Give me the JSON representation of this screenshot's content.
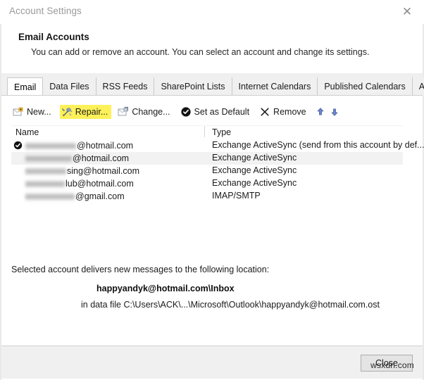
{
  "window": {
    "title": "Account Settings",
    "close_icon": "close-x-icon"
  },
  "header": {
    "title": "Email Accounts",
    "subtitle": "You can add or remove an account. You can select an account and change its settings."
  },
  "tabs": [
    {
      "label": "Email",
      "active": true
    },
    {
      "label": "Data Files",
      "active": false
    },
    {
      "label": "RSS Feeds",
      "active": false
    },
    {
      "label": "SharePoint Lists",
      "active": false
    },
    {
      "label": "Internet Calendars",
      "active": false
    },
    {
      "label": "Published Calendars",
      "active": false
    },
    {
      "label": "Address Books",
      "active": false
    }
  ],
  "toolbar": {
    "items": [
      {
        "label": "New...",
        "icon": "new-account-icon",
        "highlighted": false
      },
      {
        "label": "Repair...",
        "icon": "repair-tools-icon",
        "highlighted": true
      },
      {
        "label": "Change...",
        "icon": "change-account-icon",
        "highlighted": false
      },
      {
        "label": "Set as Default",
        "icon": "check-circle-icon",
        "highlighted": false
      },
      {
        "label": "Remove",
        "icon": "x-remove-icon",
        "highlighted": false
      }
    ],
    "move_up_icon": "arrow-up-icon",
    "move_down_icon": "arrow-down-icon",
    "highlight_color": "#fdf159"
  },
  "list": {
    "columns": [
      "Name",
      "Type"
    ],
    "rows": [
      {
        "name_redacted_width": 72,
        "name_suffix": "@hotmail.com",
        "type": "Exchange ActiveSync (send from this account by def...",
        "default": true,
        "selected": false
      },
      {
        "name_redacted_width": 66,
        "name_suffix": "@hotmail.com",
        "type": "Exchange ActiveSync",
        "default": false,
        "selected": true
      },
      {
        "name_redacted_width": 58,
        "name_suffix": "sing@hotmail.com",
        "type": "Exchange ActiveSync",
        "default": false,
        "selected": false
      },
      {
        "name_redacted_width": 56,
        "name_suffix": "lub@hotmail.com",
        "type": "Exchange ActiveSync",
        "default": false,
        "selected": false
      },
      {
        "name_redacted_width": 70,
        "name_suffix": "@gmail.com",
        "type": "IMAP/SMTP",
        "default": false,
        "selected": false
      }
    ]
  },
  "location": {
    "label": "Selected account delivers new messages to the following location:",
    "folder": "happyandyk@hotmail.com\\Inbox",
    "data_file": "in data file C:\\Users\\ACK\\...\\Microsoft\\Outlook\\happyandyk@hotmail.com.ost"
  },
  "footer": {
    "close_label": "Close",
    "watermark": "wsxdn.com"
  }
}
